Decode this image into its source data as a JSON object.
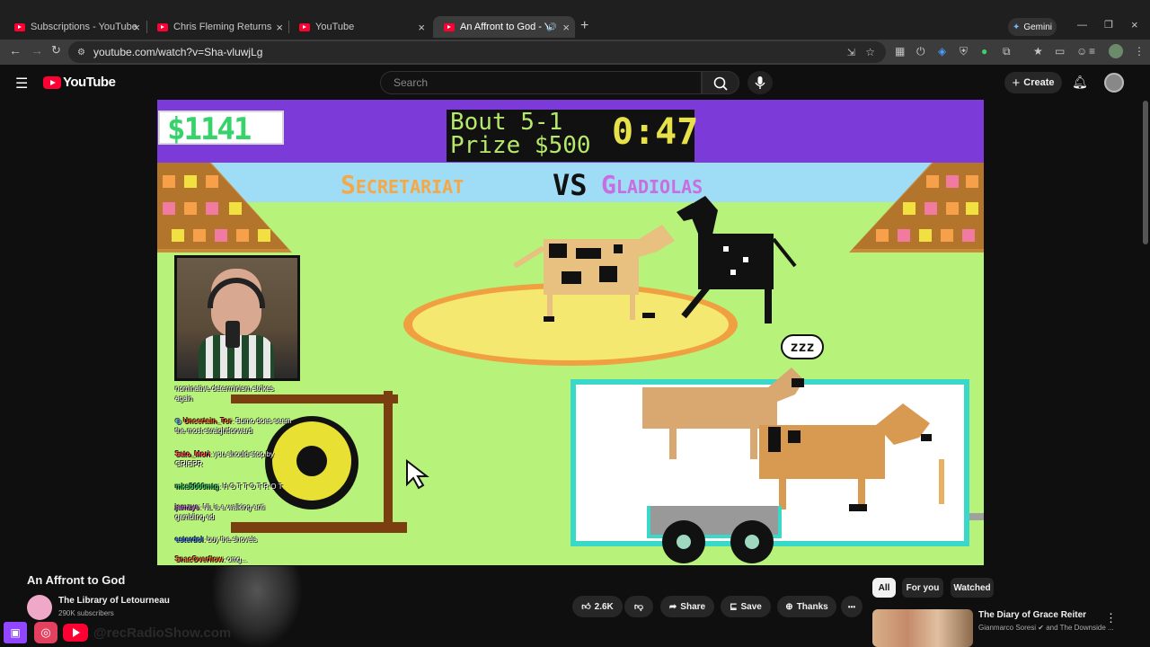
{
  "browser": {
    "tabs": [
      {
        "title": "Subscriptions - YouTube",
        "active": false
      },
      {
        "title": "Chris Fleming Returns Again - Y",
        "active": false
      },
      {
        "title": "YouTube",
        "active": false
      },
      {
        "title": "An Affront to God - YouTub",
        "active": true
      }
    ],
    "new_tab": "+",
    "gemini_label": "Gemini",
    "url": "youtube.com/watch?v=Sha-vluwjLg"
  },
  "youtube": {
    "logo_text": "YouTube",
    "search_placeholder": "Search",
    "create_label": "Create"
  },
  "game": {
    "money": "$1141",
    "bout": "Bout 5-1",
    "prize": "Prize $500",
    "timer": "0:47",
    "left_name": "Secretariat",
    "vs": "VS",
    "right_name": "Gladiolas",
    "zzz": "zzz",
    "colors": {
      "purple": "#7c3bd8",
      "sky": "#9fdcf5",
      "grass": "#b7f27a",
      "orange": "#f5a848",
      "pink": "#c86ee0",
      "green_money": "#36d36a",
      "lime": "#d7e85a"
    }
  },
  "chat": [
    {
      "user": "",
      "text": "nominative determinism strikes again"
    },
    {
      "user": "Uncertain_Tor",
      "text": "Sumo does seem the most straightforward"
    },
    {
      "user": "Sato_Mori",
      "text": "you should stop by CRISPR"
    },
    {
      "user": "mks5000mtg",
      "text": "H O T T O T R O T"
    },
    {
      "user": "jamzys",
      "text": "NL is a walking anti gambling ad"
    },
    {
      "user": "esterdol",
      "text": "buy the shovels"
    },
    {
      "user": "SnacOverflow",
      "text": "omg..."
    }
  ],
  "video_info": {
    "title": "An Affront to God",
    "channel": "The Library of Letourneau",
    "subscribers": "290K subscribers",
    "likes": "2.6K",
    "share": "Share",
    "save": "Save",
    "thanks": "Thanks",
    "more": "•••"
  },
  "filters": [
    "All",
    "For you",
    "Watched"
  ],
  "recommendation": {
    "title": "The Diary of Grace Reiter",
    "byline": "Gianmarco Soresi",
    "byline2": "and The Downside ..."
  },
  "overlay": {
    "watermark": "@recRadioShow.com"
  }
}
